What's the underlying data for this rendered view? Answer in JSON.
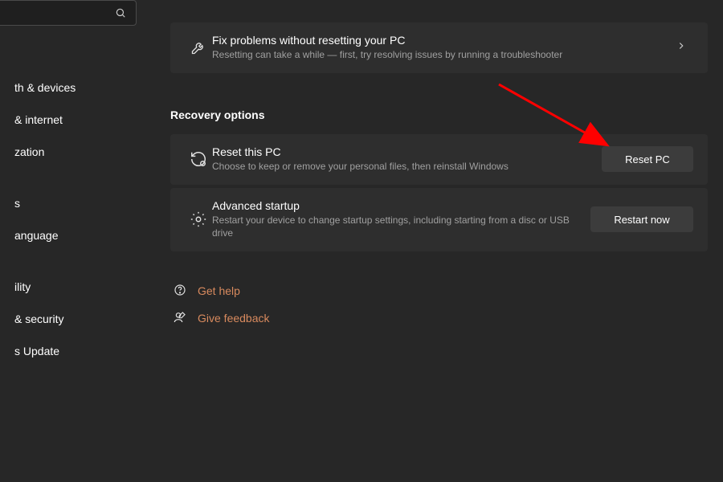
{
  "sidebar": {
    "search_placeholder": "",
    "items": [
      "th & devices",
      "& internet",
      "zation",
      "s",
      "anguage",
      "ility",
      "& security",
      "s Update"
    ]
  },
  "troubleshoot": {
    "title": "Fix problems without resetting your PC",
    "desc": "Resetting can take a while — first, try resolving issues by running a troubleshooter"
  },
  "section_title": "Recovery options",
  "reset": {
    "title": "Reset this PC",
    "desc": "Choose to keep or remove your personal files, then reinstall Windows",
    "button": "Reset PC"
  },
  "advanced": {
    "title": "Advanced startup",
    "desc": "Restart your device to change startup settings, including starting from a disc or USB drive",
    "button": "Restart now"
  },
  "links": {
    "help": "Get help",
    "feedback": "Give feedback"
  }
}
